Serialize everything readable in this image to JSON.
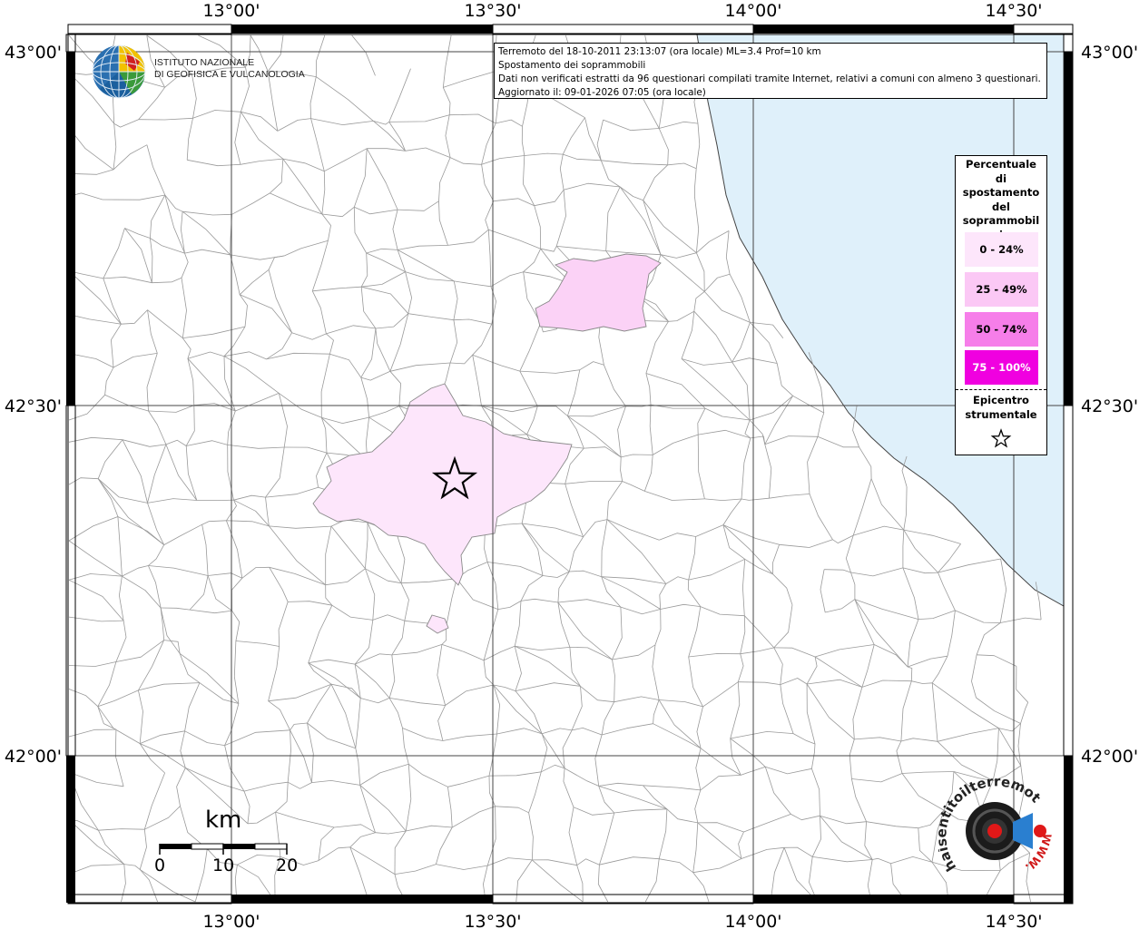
{
  "info": {
    "line1": "Terremoto del 18-10-2011 23:13:07 (ora locale) ML=3.4 Prof=10 km",
    "line2": "Spostamento dei soprammobili",
    "line3": "Dati non verificati estratti da 96 questionari compilati tramite Internet, relativi a comuni con almeno 3 questionari.",
    "line4": "Aggiornato il: 09-01-2026 07:05 (ora locale)"
  },
  "coords": {
    "top": [
      "13°00'",
      "13°30'",
      "14°00'",
      "14°30'"
    ],
    "bottom": [
      "13°00'",
      "13°30'",
      "14°00'",
      "14°30'"
    ],
    "left": [
      "43°00'",
      "42°30'",
      "42°00'"
    ],
    "right": [
      "43°00'",
      "42°30'",
      "42°00'"
    ]
  },
  "logo": {
    "line1": "ISTITUTO NAZIONALE",
    "line2": "DI GEOFISICA E VULCANOLOGIA"
  },
  "legend": {
    "title": "Percentuale di spostamento del soprammobili",
    "items": [
      {
        "label": "0 - 24%",
        "color": "#fde6fb"
      },
      {
        "label": "25 - 49%",
        "color": "#fbc8f5"
      },
      {
        "label": "50 - 74%",
        "color": "#f67ee9"
      },
      {
        "label": "75 - 100%",
        "color": "#f000e0"
      }
    ],
    "epicenter_label": "Epicentro strumentale"
  },
  "colors": {
    "sea": "#dff0fa",
    "municipality_fill": "#fde6fb",
    "border": "#000000"
  },
  "scale": {
    "unit": "km",
    "ticks": [
      "0",
      "10",
      "20"
    ]
  },
  "badge": {
    "text": "haisentitoilterremoto.it",
    "url": "WWW."
  }
}
